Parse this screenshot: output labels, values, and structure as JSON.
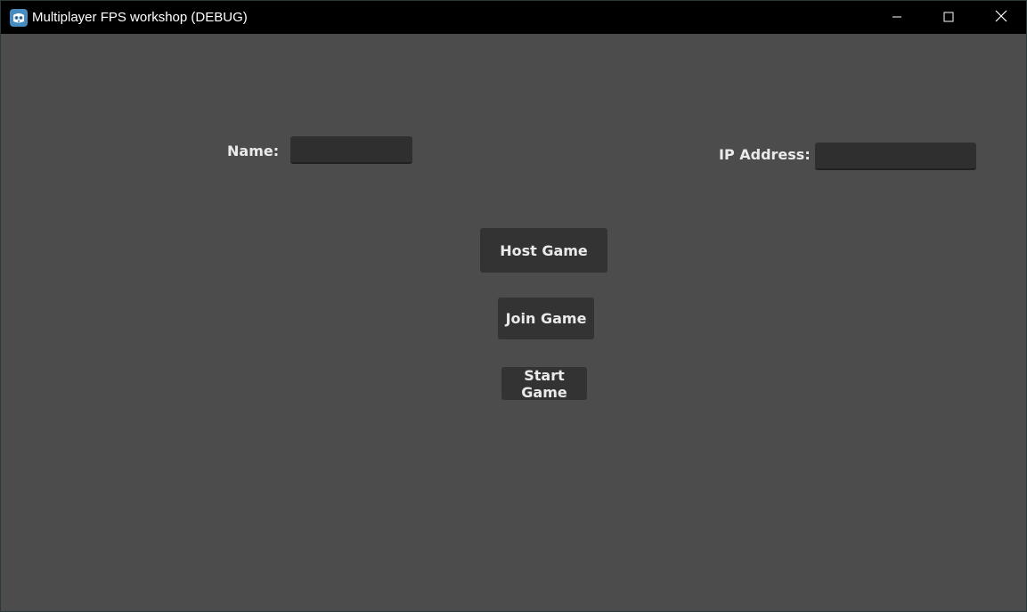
{
  "window": {
    "title": "Multiplayer FPS workshop (DEBUG)",
    "app_icon": "godot-icon",
    "controls": {
      "minimize_icon": "minimize-icon",
      "maximize_icon": "maximize-icon",
      "close_icon": "close-icon"
    }
  },
  "form": {
    "name_label": "Name:",
    "name_value": "",
    "ip_label": "IP Address:",
    "ip_value": ""
  },
  "buttons": {
    "host": "Host Game",
    "join": "Join Game",
    "start": "Start Game"
  },
  "colors": {
    "titlebar": "#000000",
    "background": "#4c4c4c",
    "button": "#333333",
    "input": "#2f2f2f",
    "text": "#eaeaea"
  }
}
